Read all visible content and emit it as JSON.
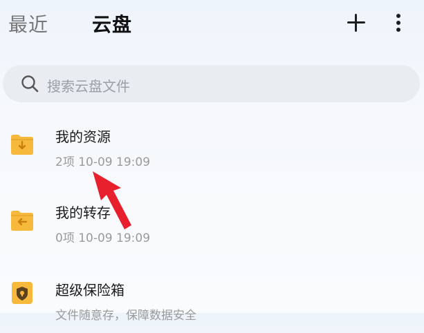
{
  "header": {
    "tab_recent": "最近",
    "tab_cloud": "云盘",
    "add_icon": "plus-icon",
    "more_icon": "more-vertical-icon"
  },
  "search": {
    "placeholder": "搜索云盘文件",
    "icon": "search-icon"
  },
  "items": [
    {
      "name": "我的资源",
      "meta": "2项 10-09 19:09",
      "icon": "folder-download-icon"
    },
    {
      "name": "我的转存",
      "meta": "0项 10-09 19:09",
      "icon": "folder-share-icon"
    },
    {
      "name": "超级保险箱",
      "meta": "文件随意存，保障数据安全",
      "icon": "safe-box-icon"
    }
  ],
  "colors": {
    "folder": "#f6b93b",
    "folder_dark": "#e9a52a",
    "arrow": "#e8202e"
  }
}
